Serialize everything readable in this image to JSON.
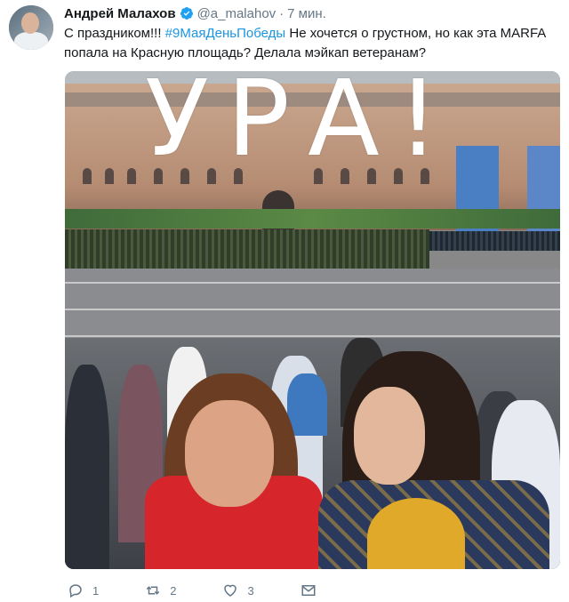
{
  "tweet": {
    "author_name": "Андрей Малахов",
    "handle": "@a_malahov",
    "separator": "·",
    "time": "7 мин.",
    "text_before": "С праздником!!! ",
    "hashtag": "#9МаяДеньПобеды",
    "text_after": " Не хочется о грустном, но как эта MARFA попала на Красную площадь? Делала мэйкап ветеранам?",
    "photo_caption": "УРА!",
    "actions": {
      "reply_count": "1",
      "retweet_count": "2",
      "like_count": "3"
    }
  },
  "icons": {
    "verified": "verified-badge-icon",
    "reply": "reply-icon",
    "retweet": "retweet-icon",
    "like": "heart-icon",
    "message": "mail-icon"
  },
  "colors": {
    "link": "#1b95e0",
    "muted": "#657786",
    "verified": "#1da1f2"
  }
}
